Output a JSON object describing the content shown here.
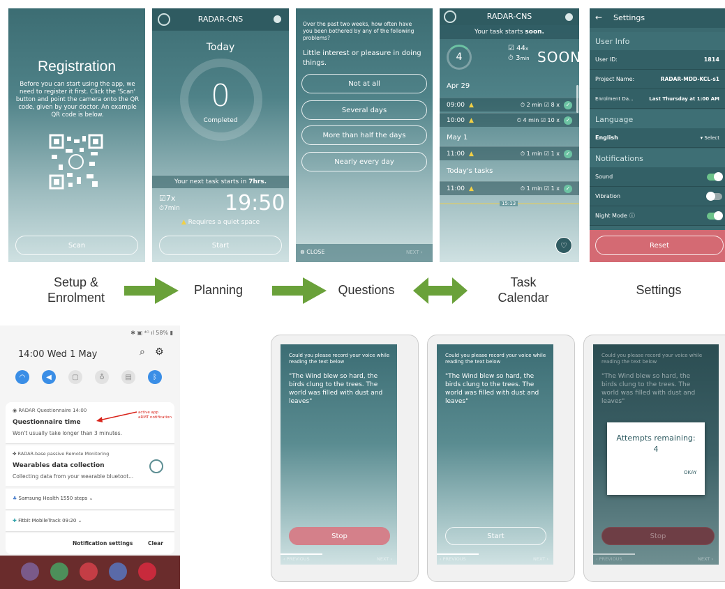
{
  "registration": {
    "title": "Registration",
    "body": "Before you can start using the app, we need to register it first. Click the 'Scan' button and point the camera onto the QR code, given by your doctor. An example QR code is below.",
    "scan_label": "Scan"
  },
  "planning": {
    "app_name": "RADAR-CNS",
    "today_label": "Today",
    "completed_count": "0",
    "completed_label": "Completed",
    "next_task_text": "Your next task starts in",
    "next_task_time": "7hrs.",
    "questions_count": "7x",
    "duration": "7min",
    "clock": "19:50",
    "requirement": "Requires a quiet space",
    "start_label": "Start"
  },
  "questions": {
    "prompt": "Over the past two weeks, how often have you been bothered by any of the following problems?",
    "question": "Little interest or pleasure in doing things.",
    "options": [
      "Not at all",
      "Several days",
      "More than half the days",
      "Nearly every day"
    ],
    "close_label": "CLOSE",
    "next_label": "NEXT"
  },
  "calendar": {
    "app_name": "RADAR-CNS",
    "banner_text": "Your task starts",
    "banner_emph": "soon.",
    "ring_value": "4",
    "questions": "44",
    "questions_suffix": "x",
    "minutes": "3",
    "minutes_suffix": "min",
    "soon_label": "SOON",
    "sections": [
      {
        "date": "Apr 29",
        "rows": [
          {
            "time": "09:00",
            "min": "2",
            "count": "8"
          },
          {
            "time": "10:00",
            "min": "4",
            "count": "10"
          }
        ]
      },
      {
        "date": "May 1",
        "rows": [
          {
            "time": "11:00",
            "min": "1",
            "count": "1"
          }
        ]
      },
      {
        "date": "Today's tasks",
        "rows": [
          {
            "time": "11:00",
            "min": "1",
            "count": "1"
          }
        ]
      }
    ],
    "now_time": "15:13"
  },
  "settings": {
    "title": "Settings",
    "user_info_header": "User Info",
    "user_id_label": "User ID:",
    "user_id_value": "1814",
    "project_label": "Project Name:",
    "project_value": "RADAR-MDD-KCL-s1",
    "enrolment_label": "Enrolment Da...",
    "enrolment_value": "Last Thursday at 1:00 AM",
    "language_header": "Language",
    "language_value": "English",
    "select_label": "Select",
    "notifications_header": "Notifications",
    "sound_label": "Sound",
    "vibration_label": "Vibration",
    "night_label": "Night Mode",
    "reset_label": "Reset",
    "sound_on": true,
    "vibration_on": false,
    "night_on": true
  },
  "flow_labels": {
    "setup": "Setup &\nEnrolment",
    "planning": "Planning",
    "questions": "Questions",
    "task_calendar": "Task\nCalendar",
    "settings": "Settings"
  },
  "phone": {
    "status_battery": "58%",
    "datetime": "14:00  Wed 1 May",
    "notifications": [
      {
        "app": "RADAR Questionnaire  14:00",
        "title": "Questionnaire time",
        "body": "Won't usually take longer than 3 minutes."
      },
      {
        "app": "RADAR-base passive Remote Monitoring",
        "title": "Wearables data collection",
        "body": "Collecting data from your wearable bluetoot..."
      },
      {
        "app": "Samsung Health  1550 steps",
        "title": "",
        "body": ""
      },
      {
        "app": "Fitbit  MobileTrack  09:20",
        "title": "",
        "body": ""
      }
    ],
    "annotation": "active app\naRMT notification",
    "settings_label": "Notification settings",
    "clear_label": "Clear"
  },
  "voice": {
    "prompt": "Could you please record your voice while reading the text below",
    "passage": "\"The Wind blew so hard, the birds clung to the trees. The world was filled with dust and leaves\"",
    "stop_label": "Stop",
    "start_label": "Start",
    "previous_label": "PREVIOUS",
    "next_label": "NEXT",
    "attempts_label": "Attempts remaining:",
    "attempts_value": "4",
    "okay_label": "OKAY"
  },
  "colors": {
    "accent": "#6aa13a",
    "teal_dark": "#2f5b61",
    "reset": "#d46a73",
    "warning": "#f2d046"
  }
}
